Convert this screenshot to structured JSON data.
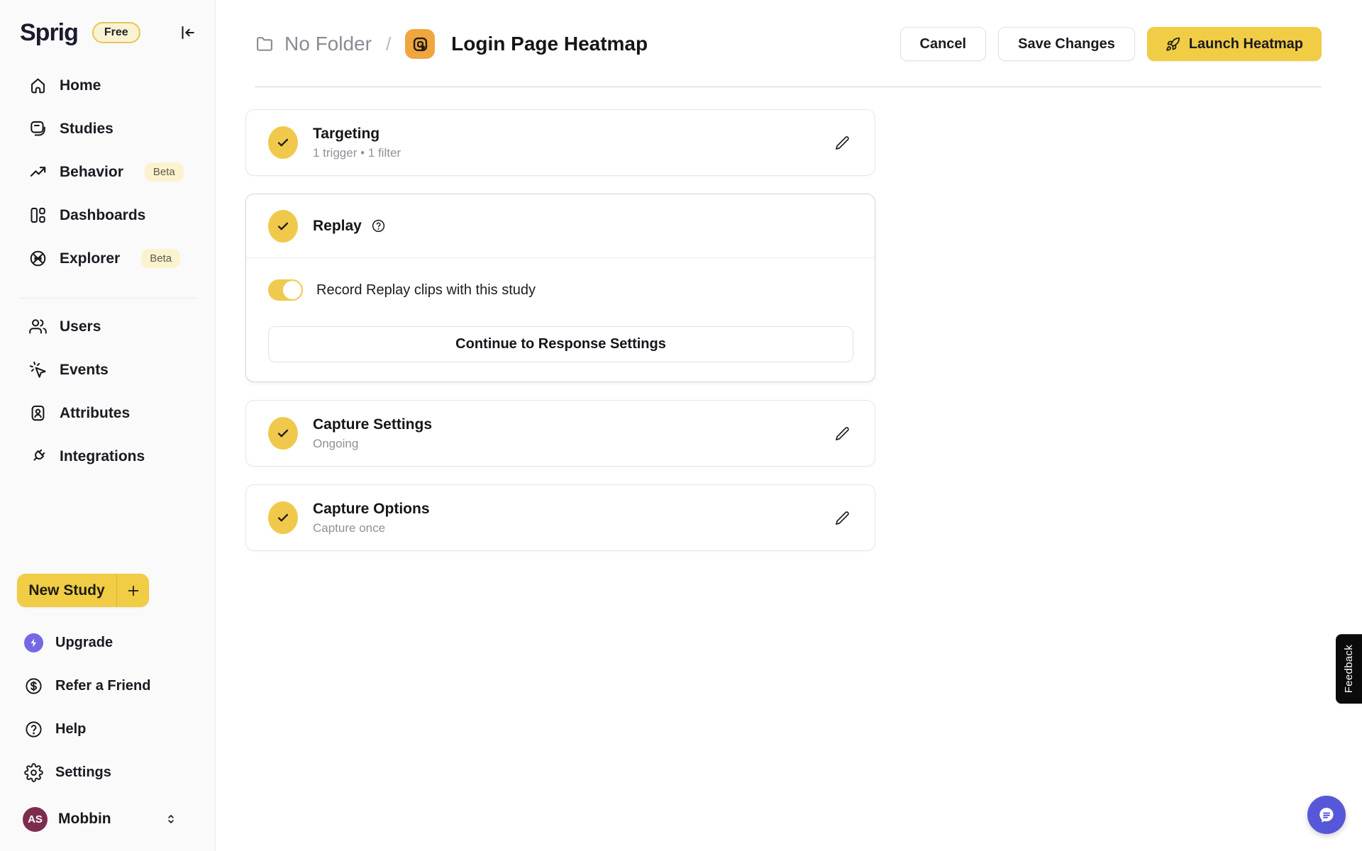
{
  "brand": {
    "logo": "Sprig",
    "plan_badge": "Free"
  },
  "sidebar": {
    "nav_main": [
      {
        "label": "Home",
        "icon": "home-icon"
      },
      {
        "label": "Studies",
        "icon": "studies-icon"
      },
      {
        "label": "Behavior",
        "icon": "behavior-icon",
        "badge": "Beta"
      },
      {
        "label": "Dashboards",
        "icon": "dashboards-icon"
      },
      {
        "label": "Explorer",
        "icon": "explorer-icon",
        "badge": "Beta"
      }
    ],
    "nav_secondary": [
      {
        "label": "Users",
        "icon": "users-icon"
      },
      {
        "label": "Events",
        "icon": "events-icon"
      },
      {
        "label": "Attributes",
        "icon": "attributes-icon"
      },
      {
        "label": "Integrations",
        "icon": "integrations-icon"
      }
    ],
    "new_study": {
      "label": "New Study"
    },
    "nav_footer": [
      {
        "label": "Upgrade",
        "icon": "upgrade-icon"
      },
      {
        "label": "Refer a Friend",
        "icon": "refer-icon"
      },
      {
        "label": "Help",
        "icon": "help-icon"
      },
      {
        "label": "Settings",
        "icon": "settings-icon"
      }
    ],
    "account": {
      "initials": "AS",
      "name": "Mobbin"
    }
  },
  "header": {
    "breadcrumb": {
      "folder": "No Folder",
      "separator": "/"
    },
    "title": "Login Page Heatmap",
    "actions": {
      "cancel": "Cancel",
      "save": "Save Changes",
      "launch": "Launch Heatmap"
    }
  },
  "sections": {
    "targeting": {
      "title": "Targeting",
      "subtitle": "1 trigger • 1 filter"
    },
    "replay": {
      "title": "Replay",
      "toggle_label": "Record Replay clips with this study",
      "toggle_state": "on",
      "continue_label": "Continue to Response Settings"
    },
    "capture_settings": {
      "title": "Capture Settings",
      "subtitle": "Ongoing"
    },
    "capture_options": {
      "title": "Capture Options",
      "subtitle": "Capture once"
    }
  },
  "feedback_tab": {
    "label": "Feedback"
  },
  "colors": {
    "accent_yellow": "#F0CB47",
    "plan_badge_bg": "#FAF3D1",
    "beta_badge_bg": "#FBF3CF",
    "chat_purple": "#5757D9",
    "upgrade_purple": "#7468E4",
    "avatar_maroon": "#7C2D4E",
    "heatmap_icon_orange": "#EFA63F"
  }
}
